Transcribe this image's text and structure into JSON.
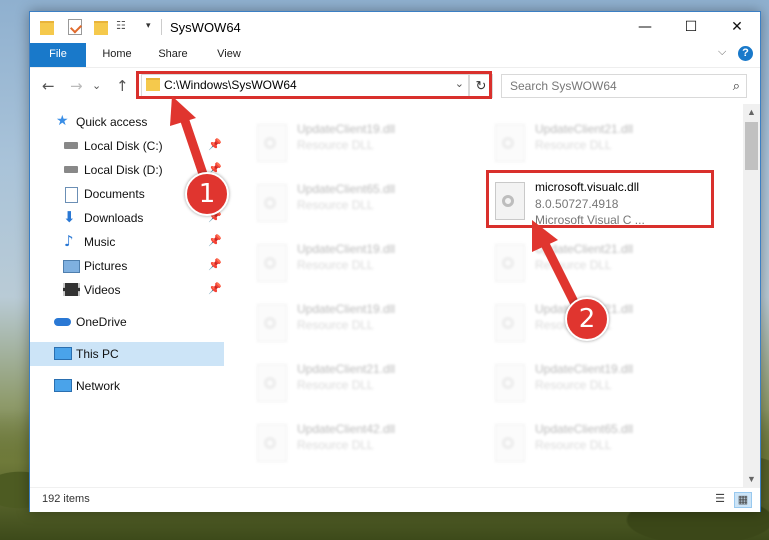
{
  "window": {
    "title": "SysWOW64",
    "min_glyph": "—",
    "max_glyph": "☐",
    "close_glyph": "✕"
  },
  "ribbon": {
    "tabs": [
      "File",
      "Home",
      "Share",
      "View"
    ],
    "collapse_glyph": "⌵",
    "help_glyph": "?"
  },
  "nav_buttons": {
    "back": "←",
    "forward": "→",
    "recent": "⌄",
    "up": "↑"
  },
  "address": {
    "path": "C:\\Windows\\SysWOW64",
    "dropdown_glyph": "⌄",
    "refresh_glyph": "↻"
  },
  "search": {
    "placeholder": "Search SysWOW64",
    "icon_glyph": "⌕"
  },
  "sidebar": {
    "pin_glyph": "📌",
    "items": [
      {
        "label": "Quick access",
        "icon": "star-icon"
      },
      {
        "label": "Local Disk (C:)",
        "icon": "drive-icon"
      },
      {
        "label": "Local Disk (D:)",
        "icon": "drive-icon"
      },
      {
        "label": "Documents",
        "icon": "documents-icon"
      },
      {
        "label": "Downloads",
        "icon": "downloads-icon"
      },
      {
        "label": "Music",
        "icon": "music-icon"
      },
      {
        "label": "Pictures",
        "icon": "pictures-icon"
      },
      {
        "label": "Videos",
        "icon": "videos-icon"
      },
      {
        "label": "OneDrive",
        "icon": "cloud-icon"
      },
      {
        "label": "This PC",
        "icon": "computer-icon"
      },
      {
        "label": "Network",
        "icon": "network-icon"
      }
    ]
  },
  "files": {
    "left": [
      {
        "name": "UpdateClient19.dll",
        "type": "Resource DLL"
      },
      {
        "name": "UpdateClient65.dll",
        "type": "Resource DLL"
      },
      {
        "name": "UpdateClient19.dll",
        "type": "Resource DLL"
      },
      {
        "name": "UpdateClient19.dll",
        "type": "Resource DLL"
      },
      {
        "name": "UpdateClient21.dll",
        "type": "Resource DLL"
      },
      {
        "name": "UpdateClient42.dll",
        "type": "Resource DLL"
      }
    ],
    "right": [
      {
        "name": "UpdateClient21.dll",
        "type": "Resource DLL"
      },
      {
        "name": "microsoft.visualc.dll",
        "version": "8.0.50727.4918",
        "desc": "Microsoft Visual C ..."
      },
      {
        "name": "UpdateClient21.dll",
        "type": "Resource DLL"
      },
      {
        "name": "UpdateClient21.dll",
        "type": "Resource DLL"
      },
      {
        "name": "UpdateClient19.dll",
        "type": "Resource DLL"
      },
      {
        "name": "UpdateClient65.dll",
        "type": "Resource DLL"
      }
    ]
  },
  "status": {
    "count": "192 items",
    "details_glyph": "☰",
    "tiles_glyph": "▦"
  },
  "callouts": [
    "1",
    "2"
  ],
  "accent": "#1979ca",
  "highlight_color": "#d9302c"
}
